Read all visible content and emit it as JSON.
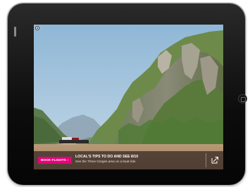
{
  "screen": {
    "image": "Three Gorges river landscape with mountains and a boat"
  },
  "info_bar": {
    "book_button_label": "BOOK FLIGHTS",
    "book_button_chevron": "›",
    "tip_title": "LOCAL'S TIPS TO DO AND SEE 8/10",
    "tip_text": "See the Three Gorges area on a boat ride."
  },
  "icons": {
    "share": "share-icon",
    "close": "close-icon",
    "home": "home-button-icon"
  },
  "colors": {
    "accent": "#e6007a",
    "bar": "#3c2d28",
    "bezel": "#0c0c0c",
    "sky": "#a9c8df"
  }
}
